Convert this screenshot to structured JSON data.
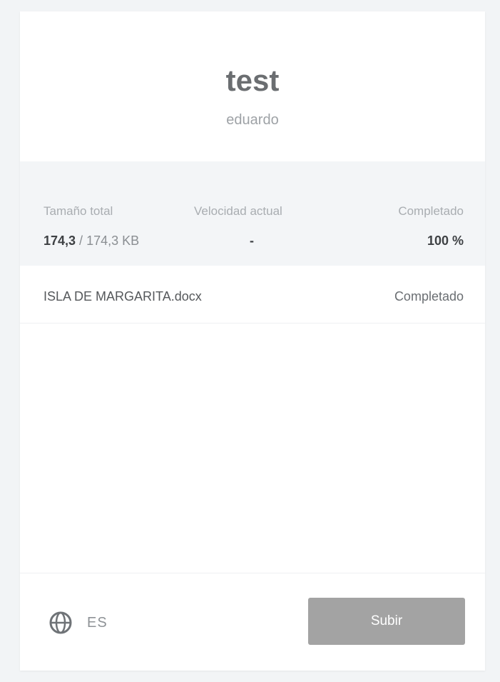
{
  "header": {
    "title": "test",
    "subtitle": "eduardo"
  },
  "stats": {
    "total_size": {
      "label": "Tamaño total",
      "uploaded": "174,3",
      "separator": " / ",
      "total": "174,3 KB"
    },
    "current_speed": {
      "label": "Velocidad actual",
      "value": "-"
    },
    "completed": {
      "label": "Completado",
      "value": "100 %"
    }
  },
  "files": [
    {
      "name": "ISLA DE MARGARITA.docx",
      "status": "Completado"
    }
  ],
  "footer": {
    "language_icon": "globe-icon",
    "language_code": "ES",
    "upload_label": "Subir"
  },
  "colors": {
    "background": "#f2f4f6",
    "card": "#ffffff",
    "stats_band": "#f3f5f7",
    "button": "#a3a3a3"
  }
}
